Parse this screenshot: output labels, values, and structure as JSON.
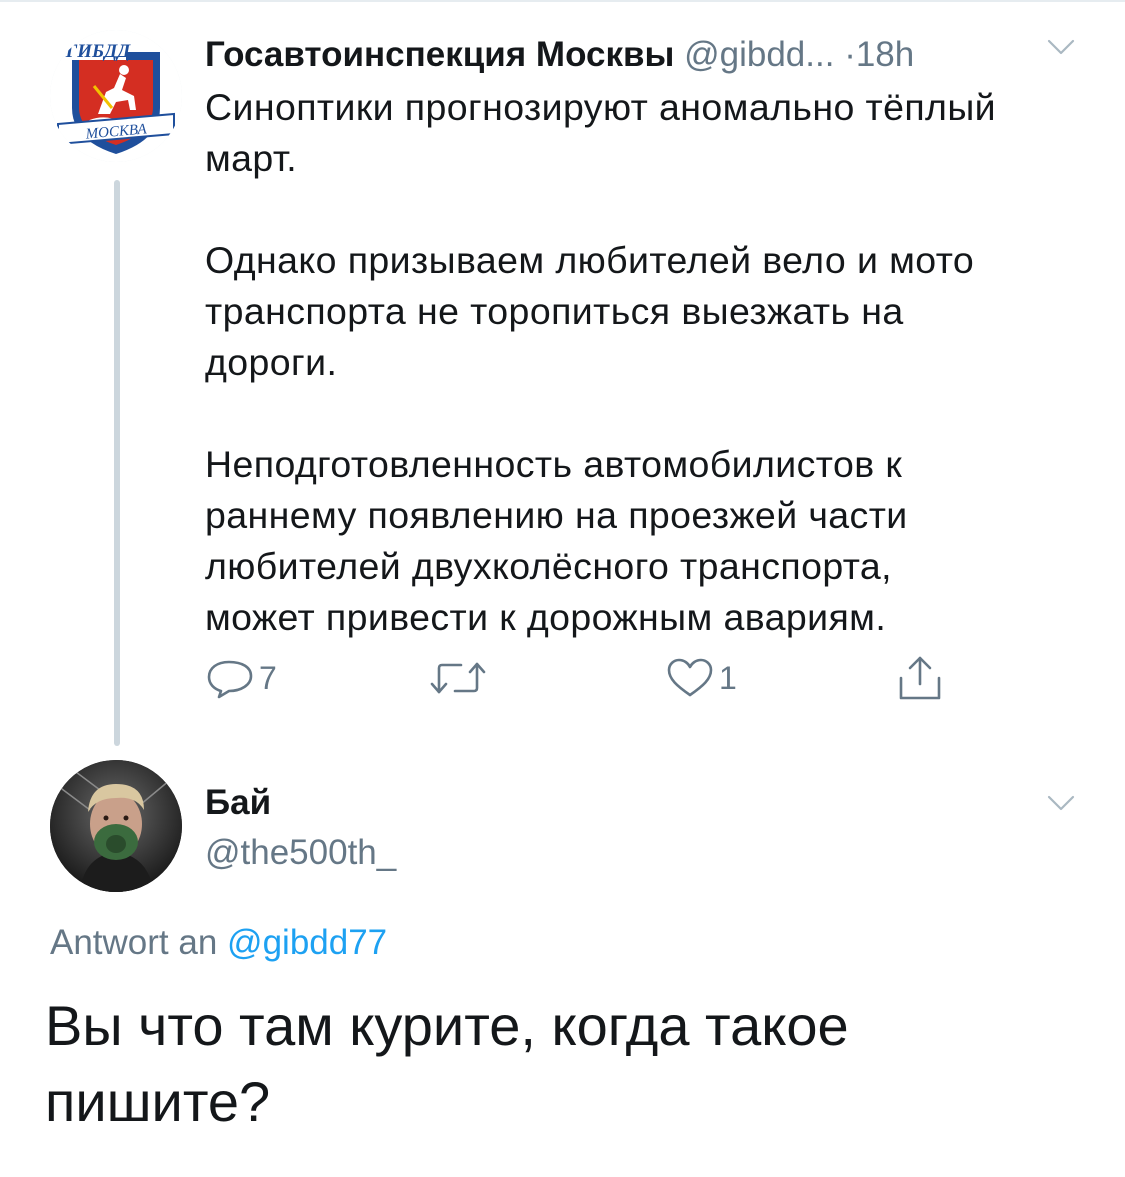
{
  "tweet": {
    "author_name": "Госавтоинспекция Москвы",
    "author_handle": "@gibdd...",
    "separator": "·",
    "time": "18h",
    "avatar": {
      "icon": "gibdd-moscow-emblem",
      "top_text": "ГИБДД",
      "bottom_text": "МОСКВА"
    },
    "paragraphs": [
      "Синоптики прогнозируют аномально тёплый\nмарт.",
      "Однако призываем любителей вело и мото\nтранспорта  не торопиться выезжать на\nдороги.",
      "Неподготовленность автомобилистов к\nраннему появлению на проезжей части\nлюбителей двухколёсного транспорта,\nможет привести к дорожным авариям."
    ],
    "actions": {
      "reply": {
        "icon": "reply-icon",
        "count": "7"
      },
      "retweet": {
        "icon": "retweet-icon",
        "count": ""
      },
      "like": {
        "icon": "like-icon",
        "count": "1"
      },
      "share": {
        "icon": "share-icon",
        "count": ""
      }
    }
  },
  "reply": {
    "author_name": "Бай",
    "author_handle": "@the500th_",
    "replying_to_label": "Antwort an",
    "replying_to_handle": "@gibdd77",
    "text": "Вы что там курите, когда такое\nпишите?"
  },
  "colors": {
    "text": "#14171a",
    "secondary": "#657786",
    "accent": "#1da1f2",
    "thread_line": "#ccd6dd",
    "emblem_red": "#d42e22",
    "emblem_blue": "#1f4f9c"
  }
}
